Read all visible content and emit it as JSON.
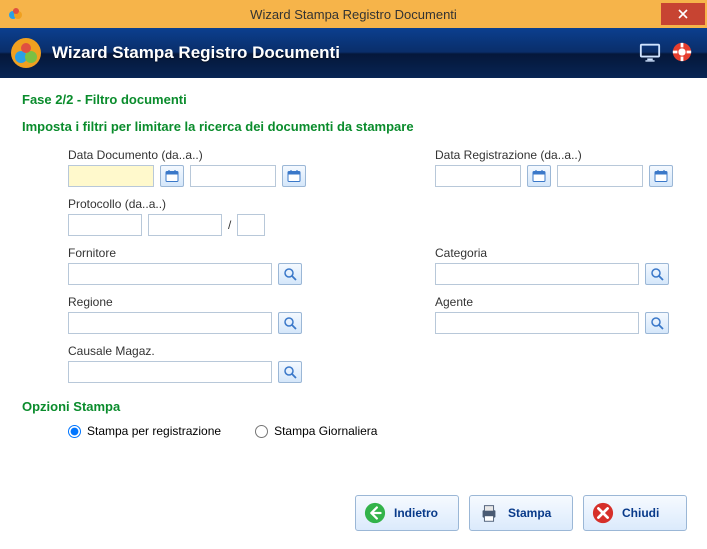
{
  "window": {
    "title": "Wizard Stampa Registro Documenti"
  },
  "header": {
    "title": "Wizard Stampa Registro Documenti"
  },
  "step": {
    "title": "Fase 2/2 - Filtro documenti"
  },
  "filters": {
    "title": "Imposta i filtri per limitare la ricerca dei documenti da stampare",
    "data_documento": {
      "label": "Data Documento (da..a..)",
      "from": "",
      "to": ""
    },
    "data_registrazione": {
      "label": "Data Registrazione (da..a..)",
      "from": "",
      "to": ""
    },
    "protocollo": {
      "label": "Protocollo (da..a..)",
      "from": "",
      "to": "",
      "suffix": ""
    },
    "fornitore": {
      "label": "Fornitore",
      "value": ""
    },
    "categoria": {
      "label": "Categoria",
      "value": ""
    },
    "regione": {
      "label": "Regione",
      "value": ""
    },
    "agente": {
      "label": "Agente",
      "value": ""
    },
    "causale": {
      "label": "Causale Magaz.",
      "value": ""
    }
  },
  "options": {
    "title": "Opzioni Stampa",
    "per_registrazione": "Stampa per registrazione",
    "giornaliera": "Stampa Giornaliera",
    "selected": "per_registrazione"
  },
  "footer": {
    "back": "Indietro",
    "print": "Stampa",
    "close": "Chiudi"
  }
}
